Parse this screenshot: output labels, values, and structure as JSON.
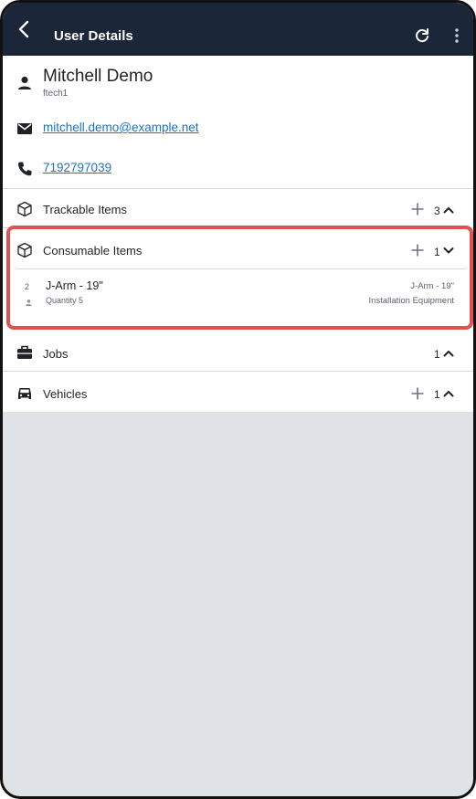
{
  "header": {
    "title": "User Details",
    "back_icon": "chevron-left-icon",
    "refresh_icon": "refresh-icon",
    "more_icon": "more-vertical-icon"
  },
  "user": {
    "name": "Mitchell Demo",
    "username": "ftech1",
    "email": "mitchell.demo@example.net",
    "phone": "7192797039"
  },
  "sections": {
    "trackable": {
      "label": "Trackable Items",
      "count": "3"
    },
    "consumable": {
      "label": "Consumable Items",
      "count": "1",
      "items": [
        {
          "number": "2",
          "name": "J-Arm - 19\"",
          "quantity": "Quantity 5",
          "right_name": "J-Arm - 19\"",
          "category": "Installation Equipment"
        }
      ]
    },
    "jobs": {
      "label": "Jobs",
      "count": "1"
    },
    "vehicles": {
      "label": "Vehicles",
      "count": "1"
    }
  },
  "colors": {
    "app_bar": "#1b2638",
    "link": "#1a73c8",
    "highlight": "#e05252",
    "empty_area": "#dfe2e6"
  }
}
